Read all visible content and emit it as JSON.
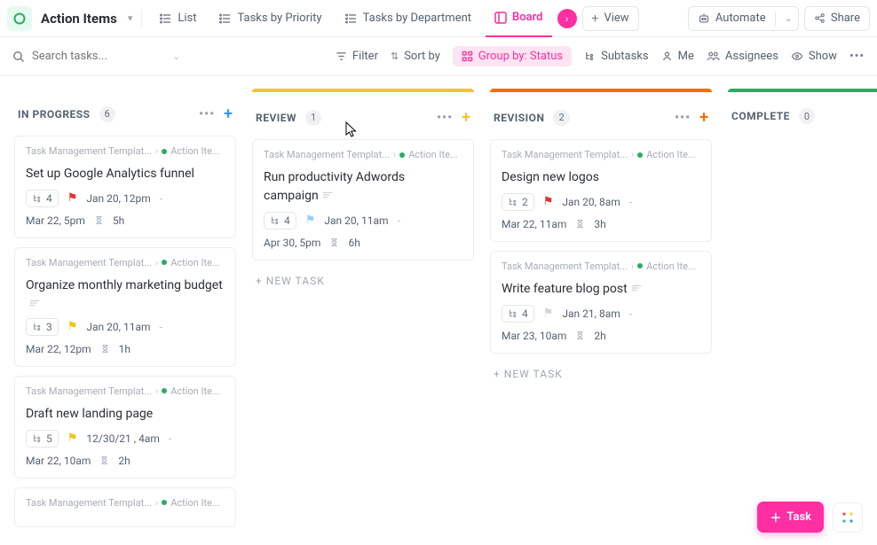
{
  "header": {
    "title": "Action Items",
    "views": [
      {
        "label": "List",
        "active": false
      },
      {
        "label": "Tasks by Priority",
        "active": false
      },
      {
        "label": "Tasks by Department",
        "active": false
      },
      {
        "label": "Board",
        "active": true
      }
    ],
    "add_view_label": "View",
    "automate_label": "Automate",
    "share_label": "Share"
  },
  "filterbar": {
    "search_placeholder": "Search tasks...",
    "items": {
      "filter": "Filter",
      "sort": "Sort by",
      "group": "Group by: Status",
      "subtasks": "Subtasks",
      "me": "Me",
      "assignees": "Assignees",
      "show": "Show"
    }
  },
  "columns": [
    {
      "key": "in_progress",
      "name": "IN PROGRESS",
      "count": "6",
      "color": "blue",
      "cards": [
        {
          "title": "Set up Google Analytics funnel",
          "breadcrumb": {
            "a": "Task Management Templat...",
            "b": "Action Ite..."
          },
          "has_desc": false,
          "subtasks": "4",
          "flag": "red",
          "due": "Jan 20, 12pm",
          "footer_date": "Mar 22, 5pm",
          "est": "5h"
        },
        {
          "title": "Organize monthly marketing budget",
          "breadcrumb": {
            "a": "Task Management Templat...",
            "b": "Action Ite..."
          },
          "has_desc": true,
          "subtasks": "3",
          "flag": "yellow",
          "due": "Jan 20, 11am",
          "footer_date": "Mar 22, 12pm",
          "est": "1h"
        },
        {
          "title": "Draft new landing page",
          "breadcrumb": {
            "a": "Task Management Templat...",
            "b": "Action Ite..."
          },
          "has_desc": false,
          "subtasks": "5",
          "flag": "yellow",
          "due": "12/30/21 , 4am",
          "footer_date": "Mar 22, 10am",
          "est": "2h"
        },
        {
          "title": "",
          "breadcrumb": {
            "a": "Task Management Templat...",
            "b": "Action Ite..."
          },
          "has_desc": false,
          "subtasks": "",
          "flag": "",
          "due": "",
          "footer_date": "",
          "est": ""
        }
      ]
    },
    {
      "key": "review",
      "name": "REVIEW",
      "count": "1",
      "color": "yellow",
      "cards": [
        {
          "title": "Run productivity Adwords campaign",
          "breadcrumb": {
            "a": "Task Management Templat...",
            "b": "Action Ite..."
          },
          "has_desc": true,
          "subtasks": "4",
          "flag": "blue",
          "due": "Jan 20, 11am",
          "footer_date": "Apr 30, 5pm",
          "est": "6h"
        }
      ],
      "new_task_label": "+ NEW TASK"
    },
    {
      "key": "revision",
      "name": "REVISION",
      "count": "2",
      "color": "orange",
      "cards": [
        {
          "title": "Design new logos",
          "breadcrumb": {
            "a": "Task Management Templat...",
            "b": "Action Ite..."
          },
          "has_desc": false,
          "subtasks": "2",
          "flag": "red",
          "due": "Jan 20, 8am",
          "footer_date": "Mar 22, 11am",
          "est": "3h"
        },
        {
          "title": "Write feature blog post",
          "breadcrumb": {
            "a": "Task Management Templat...",
            "b": "Action Ite..."
          },
          "has_desc": true,
          "subtasks": "4",
          "flag": "grey",
          "due": "Jan 21, 8am",
          "footer_date": "Mar 23, 10am",
          "est": "2h"
        }
      ],
      "new_task_label": "+ NEW TASK"
    },
    {
      "key": "complete",
      "name": "COMPLETE",
      "count": "0",
      "color": "green",
      "cards": []
    }
  ],
  "fab": {
    "task": "Task"
  }
}
